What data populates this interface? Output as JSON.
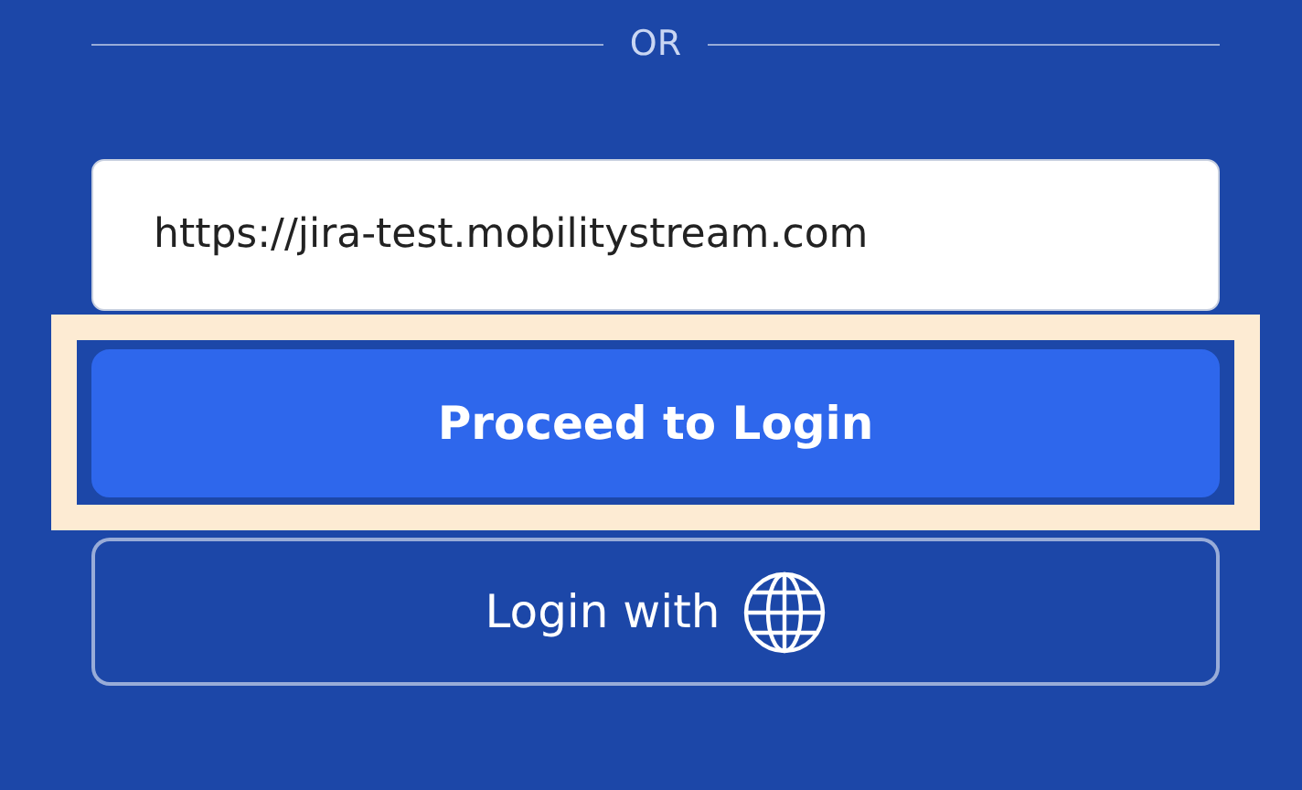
{
  "divider": {
    "label": "OR"
  },
  "url_field": {
    "value": "https://jira-test.mobilitystream.com"
  },
  "buttons": [
    {
      "kind": "primary",
      "label": "Proceed to Login",
      "highlighted": true
    },
    {
      "kind": "outline",
      "label": "Login with",
      "highlighted": false
    }
  ]
}
